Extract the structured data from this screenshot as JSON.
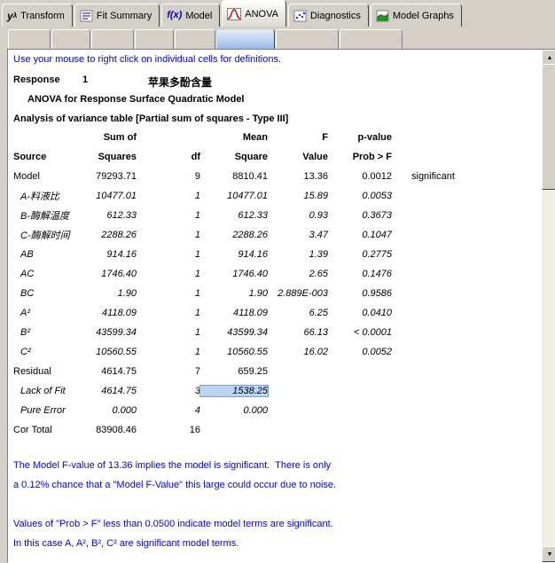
{
  "tabs": [
    {
      "label": "Transform",
      "icon": "y-lambda-icon"
    },
    {
      "label": "Fit Summary",
      "icon": "fit-summary-icon"
    },
    {
      "label": "Model",
      "icon": "fx-icon"
    },
    {
      "label": "ANOVA",
      "icon": "anova-curve-icon",
      "active": true
    },
    {
      "label": "Diagnostics",
      "icon": "diagnostics-scatter-icon"
    },
    {
      "label": "Model Graphs",
      "icon": "model-graphs-icon"
    }
  ],
  "report": {
    "hint": "Use your mouse to right click on individual cells for definitions.",
    "response_label": "Response",
    "response_number": "1",
    "response_name": "苹果多酚含量",
    "model_title": "ANOVA for Response Surface Quadratic Model",
    "table_title": "Analysis of variance table [Partial sum of squares - Type III]",
    "table": {
      "header_top": {
        "ss": "Sum of",
        "ms": "Mean",
        "f": "F",
        "p": "p-value"
      },
      "header_bottom": {
        "source": "Source",
        "ss": "Squares",
        "df": "df",
        "ms": "Square",
        "f": "Value",
        "p": "Prob > F"
      },
      "rows": [
        {
          "source": "Model",
          "ss": "79293.71",
          "df": "9",
          "ms": "8810.41",
          "f": "13.36",
          "p": "0.0012",
          "note": "significant",
          "italic": false
        },
        {
          "source": "A-料液比",
          "ss": "10477.01",
          "df": "1",
          "ms": "10477.01",
          "f": "15.89",
          "p": "0.0053",
          "italic": true
        },
        {
          "source": "B-酶解温度",
          "ss": "612.33",
          "df": "1",
          "ms": "612.33",
          "f": "0.93",
          "p": "0.3673",
          "italic": true
        },
        {
          "source": "C-酶解时间",
          "ss": "2288.26",
          "df": "1",
          "ms": "2288.26",
          "f": "3.47",
          "p": "0.1047",
          "italic": true
        },
        {
          "source": "AB",
          "ss": "914.16",
          "df": "1",
          "ms": "914.16",
          "f": "1.39",
          "p": "0.2775",
          "italic": true
        },
        {
          "source": "AC",
          "ss": "1746.40",
          "df": "1",
          "ms": "1746.40",
          "f": "2.65",
          "p": "0.1476",
          "italic": true
        },
        {
          "source": "BC",
          "ss": "1.90",
          "df": "1",
          "ms": "1.90",
          "f": "2.889E-003",
          "p": "0.9586",
          "italic": true
        },
        {
          "source": "A²",
          "ss": "4118.09",
          "df": "1",
          "ms": "4118.09",
          "f": "6.25",
          "p": "0.0410",
          "italic": true
        },
        {
          "source": "B²",
          "ss": "43599.34",
          "df": "1",
          "ms": "43599.34",
          "f": "66.13",
          "p": "< 0.0001",
          "italic": true
        },
        {
          "source": "C²",
          "ss": "10560.55",
          "df": "1",
          "ms": "10560.55",
          "f": "16.02",
          "p": "0.0052",
          "italic": true
        },
        {
          "source": "Residual",
          "ss": "4614.75",
          "df": "7",
          "ms": "659.25",
          "italic": false
        },
        {
          "source": "Lack of Fit",
          "ss": "4614.75",
          "df": "3",
          "ms": "1538.25",
          "italic": true,
          "highlight_ms": true
        },
        {
          "source": "Pure Error",
          "ss": "0.000",
          "df": "4",
          "ms": "0.000",
          "italic": true
        },
        {
          "source": "Cor Total",
          "ss": "83908.46",
          "df": "16",
          "italic": false
        }
      ]
    },
    "notes": [
      "The Model F-value of 13.36 implies the model is significant.  There is only",
      "a 0.12% chance that a \"Model F-Value\" this large could occur due to noise.",
      "",
      "Values of \"Prob > F\" less than 0.0500 indicate model terms are significant.",
      "In this case A, A², B², C² are significant model terms."
    ]
  },
  "scrollbar": {
    "up_glyph": "▲",
    "down_glyph": "▼"
  },
  "colors": {
    "chrome": "#d4d0c8",
    "link_blue": "#0000ff",
    "highlight_cell": "#bcd4f4",
    "anova_curve_red": "#cc0000",
    "graph_green": "#229922",
    "diag_blue": "#0040c0"
  }
}
